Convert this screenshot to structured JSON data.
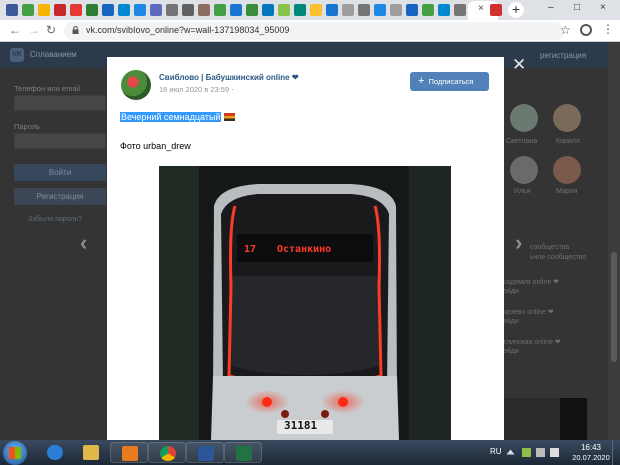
{
  "browser": {
    "url": "vk.com/svibIovo_online?w=wall-137198034_95009",
    "new_tab_symbol": "+",
    "active_tab_close": "×",
    "window_controls": [
      "–",
      "□",
      "×"
    ]
  },
  "vk": {
    "header_name": "Сплаванием",
    "register_link": "регистрация",
    "login": {
      "phone_label": "Телефон или email",
      "password_label": "Пароль",
      "login_button": "Войти",
      "register_button": "Регистрация",
      "forgot_link": "Забыли пароль?"
    },
    "sidebar_right": {
      "friend_names": [
        "Светлана",
        "Кирилл",
        "Илья",
        "Мария"
      ],
      "lines": [
        "сообщества",
        "ьное сообщество",
        "кадемия online ❤",
        "ейди",
        "ирзево online ❤",
        "ейди",
        "тлинская online ❤",
        "ейди"
      ]
    }
  },
  "post": {
    "community_name": "Свиблово | Бабушкинский online",
    "heart": "❤",
    "date": "16 июл 2020 в 23:59",
    "pin": "⋅",
    "subscribe_button": "Подписаться",
    "subscribe_plus": "+",
    "title_highlighted": "Вечерний семнадцатый",
    "photo_credit": "Фото urban_drew",
    "photo": {
      "route_number": "17",
      "destination": "Останкино",
      "fleet_number": "31181"
    }
  },
  "modal_controls": {
    "close": "✕",
    "prev": "‹",
    "next": "›"
  },
  "taskbar": {
    "language": "RU",
    "time": "16:43",
    "date": "20.07.2020"
  },
  "colors": {
    "vk_blue": "#5181b8",
    "link_blue": "#2a5885",
    "highlight": "#3399ff",
    "tram_red": "#ff3b25"
  }
}
